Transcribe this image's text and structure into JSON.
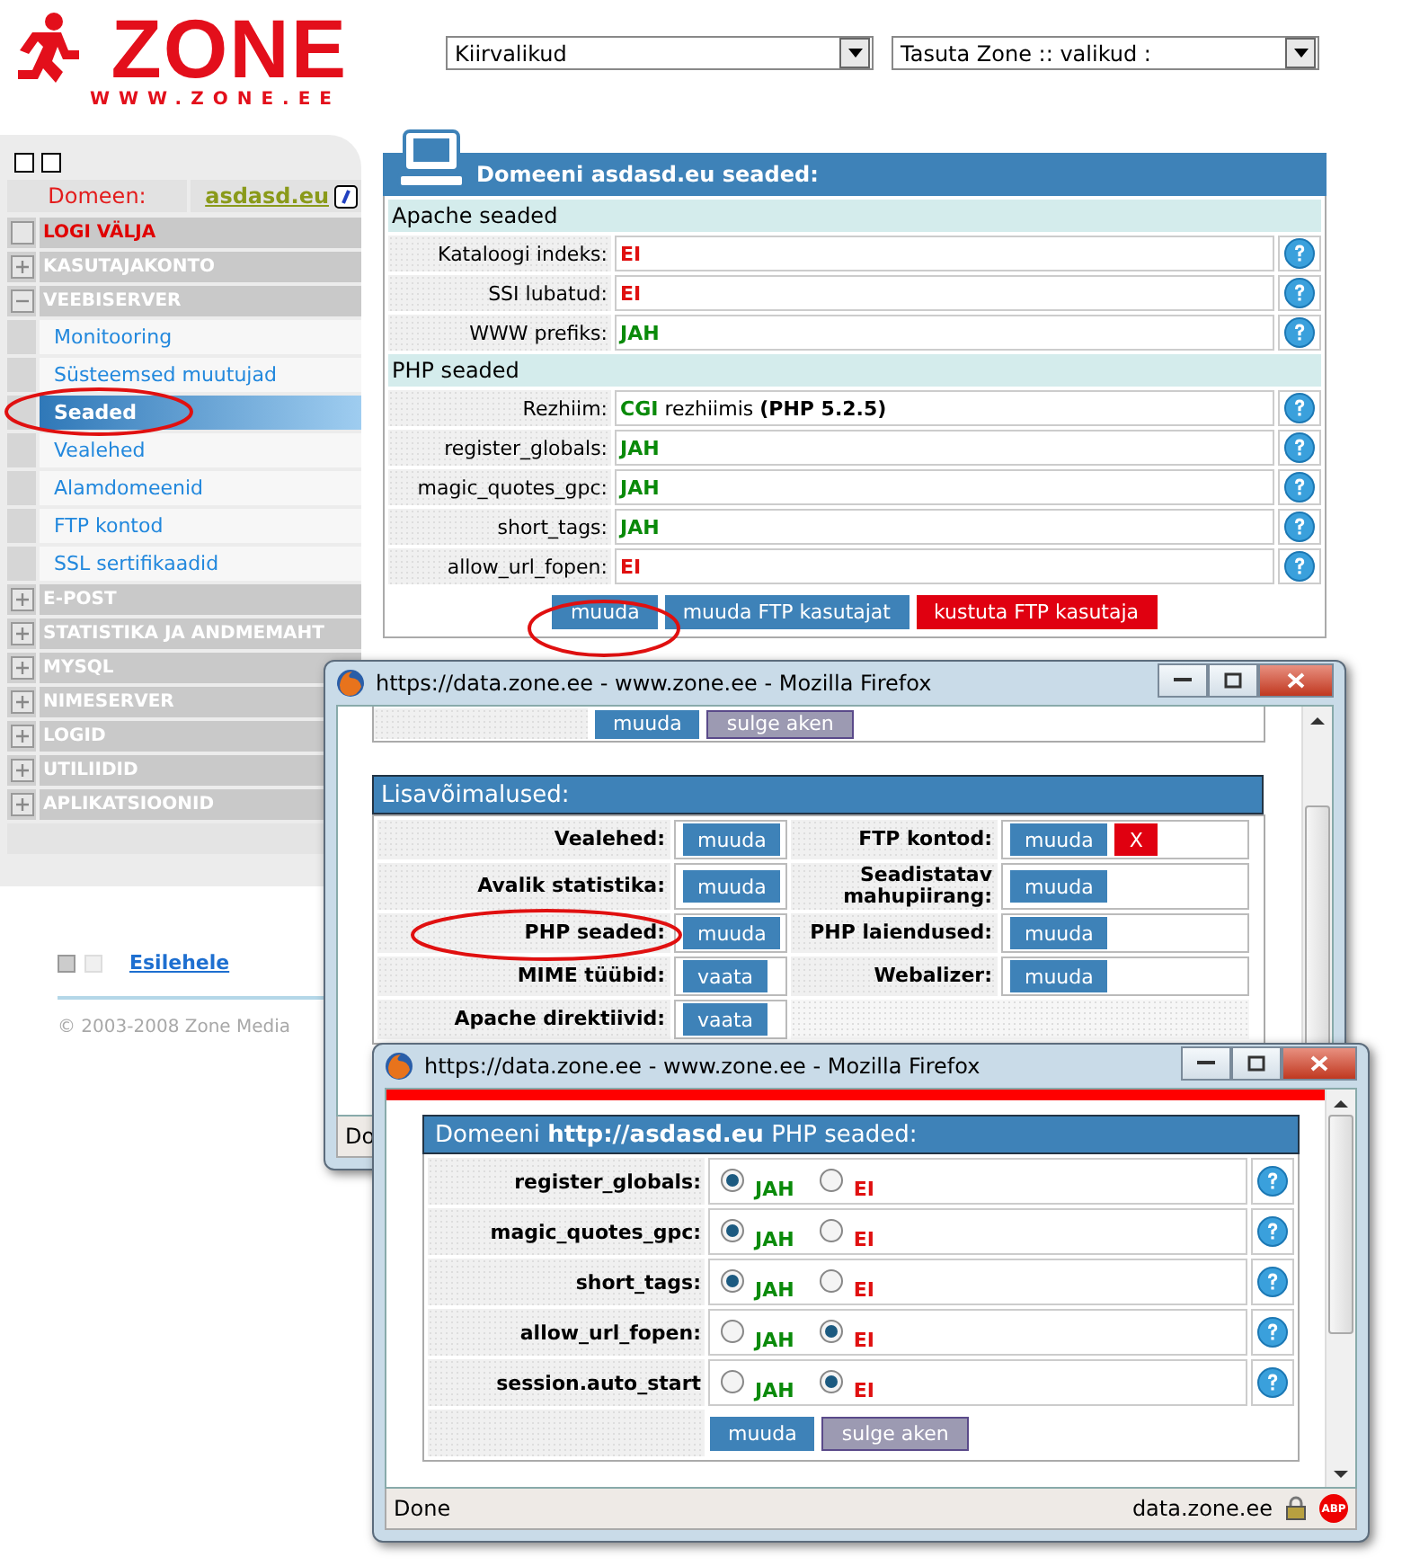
{
  "logo": {
    "wordmark": "ZONE",
    "url": "WWW.ZONE.EE"
  },
  "sidebar": {
    "domain_label": "Domeen:",
    "domain": "asdasd.eu",
    "menu": [
      {
        "label": "LOGI VÄLJA",
        "kind": "logout"
      },
      {
        "label": "KASUTAJAKONTO",
        "kind": "section",
        "expanded": false
      },
      {
        "label": "VEEBISERVER",
        "kind": "section",
        "expanded": true,
        "children": [
          {
            "label": "Monitooring",
            "selected": false
          },
          {
            "label": "Süsteemsed muutujad",
            "selected": false
          },
          {
            "label": "Seaded",
            "selected": true
          },
          {
            "label": "Vealehed",
            "selected": false
          },
          {
            "label": "Alamdomeenid",
            "selected": false
          },
          {
            "label": "FTP kontod",
            "selected": false
          },
          {
            "label": "SSL sertifikaadid",
            "selected": false
          }
        ]
      },
      {
        "label": "E-POST",
        "kind": "section",
        "expanded": false
      },
      {
        "label": "STATISTIKA JA ANDMEMAHT",
        "kind": "section",
        "expanded": false
      },
      {
        "label": "MYSQL",
        "kind": "section",
        "expanded": false
      },
      {
        "label": "NIMESERVER",
        "kind": "section",
        "expanded": false
      },
      {
        "label": "LOGID",
        "kind": "section",
        "expanded": false
      },
      {
        "label": "UTILIIDID",
        "kind": "section",
        "expanded": false
      },
      {
        "label": "APLIKATSIOONID",
        "kind": "section",
        "expanded": false
      }
    ]
  },
  "footer": {
    "link": "Esilehele",
    "copyright": "© 2003-2008 Zone Media"
  },
  "selects": [
    {
      "value": "Kiirvalikud"
    },
    {
      "value": "Tasuta Zone :: valikud :"
    }
  ],
  "settings": {
    "title": "Domeeni asdasd.eu seaded:",
    "sections": [
      {
        "heading": "Apache seaded",
        "rows": [
          {
            "label": "Kataloogi indeks:",
            "value": [
              {
                "text": "EI",
                "kind": "no"
              }
            ]
          },
          {
            "label": "SSI lubatud:",
            "value": [
              {
                "text": "EI",
                "kind": "no"
              }
            ]
          },
          {
            "label": "WWW prefiks:",
            "value": [
              {
                "text": "JAH",
                "kind": "yes"
              }
            ]
          }
        ]
      },
      {
        "heading": "PHP seaded",
        "rows": [
          {
            "label": "Rezhiim:",
            "value": [
              {
                "text": "CGI",
                "kind": "yes"
              },
              {
                "text": "rezhiimis",
                "kind": "plain"
              },
              {
                "text": "(PHP 5.2.5)",
                "kind": "bold"
              }
            ]
          },
          {
            "label": "register_globals:",
            "value": [
              {
                "text": "JAH",
                "kind": "yes"
              }
            ]
          },
          {
            "label": "magic_quotes_gpc:",
            "value": [
              {
                "text": "JAH",
                "kind": "yes"
              }
            ]
          },
          {
            "label": "short_tags:",
            "value": [
              {
                "text": "JAH",
                "kind": "yes"
              }
            ]
          },
          {
            "label": "allow_url_fopen:",
            "value": [
              {
                "text": "EI",
                "kind": "no"
              }
            ]
          }
        ]
      }
    ],
    "buttons": [
      {
        "label": "muuda",
        "kind": "primary"
      },
      {
        "label": "muuda FTP kasutajat",
        "kind": "primary"
      },
      {
        "label": "kustuta FTP kasutaja",
        "kind": "danger"
      }
    ]
  },
  "popup": {
    "title": "https://data.zone.ee - www.zone.ee - Mozilla Firefox",
    "top_buttons": [
      {
        "label": "muuda",
        "kind": "primary"
      },
      {
        "label": "sulge aken",
        "kind": "secondary"
      }
    ],
    "extras_title": "Lisavõimalused:",
    "extras": [
      {
        "label": "Vealehed:",
        "buttons": [
          {
            "label": "muuda",
            "kind": "primary"
          }
        ]
      },
      {
        "label": "FTP kontod:",
        "buttons": [
          {
            "label": "muuda",
            "kind": "primary"
          },
          {
            "label": "X",
            "kind": "danger"
          }
        ]
      },
      {
        "label": "Avalik statistika:",
        "buttons": [
          {
            "label": "muuda",
            "kind": "primary"
          }
        ]
      },
      {
        "label": "Seadistatav mahupiirang:",
        "buttons": [
          {
            "label": "muuda",
            "kind": "primary"
          }
        ]
      },
      {
        "label": "PHP seaded:",
        "buttons": [
          {
            "label": "muuda",
            "kind": "primary"
          }
        ]
      },
      {
        "label": "PHP laiendused:",
        "buttons": [
          {
            "label": "muuda",
            "kind": "primary"
          }
        ]
      },
      {
        "label": "MIME tüübid:",
        "buttons": [
          {
            "label": "vaata",
            "kind": "primary"
          }
        ]
      },
      {
        "label": "Webalizer:",
        "buttons": [
          {
            "label": "muuda",
            "kind": "primary"
          }
        ]
      },
      {
        "label": "Apache direktiivid:",
        "buttons": [
          {
            "label": "vaata",
            "kind": "primary"
          }
        ]
      }
    ],
    "status": "Do"
  },
  "php_popup": {
    "title": "https://data.zone.ee - www.zone.ee - Mozilla Firefox",
    "heading": "Domeeni **http://asdasd.eu** PHP seaded:",
    "rows": [
      {
        "label": "register_globals:",
        "options": [
          {
            "label": "JAH",
            "kind": "yes",
            "selected": true
          },
          {
            "label": "EI",
            "kind": "no",
            "selected": false
          }
        ]
      },
      {
        "label": "magic_quotes_gpc:",
        "options": [
          {
            "label": "JAH",
            "kind": "yes",
            "selected": true
          },
          {
            "label": "EI",
            "kind": "no",
            "selected": false
          }
        ]
      },
      {
        "label": "short_tags:",
        "options": [
          {
            "label": "JAH",
            "kind": "yes",
            "selected": true
          },
          {
            "label": "EI",
            "kind": "no",
            "selected": false
          }
        ]
      },
      {
        "label": "allow_url_fopen:",
        "options": [
          {
            "label": "JAH",
            "kind": "yes",
            "selected": false
          },
          {
            "label": "EI",
            "kind": "no",
            "selected": true
          }
        ]
      },
      {
        "label": "session.auto_start",
        "options": [
          {
            "label": "JAH",
            "kind": "yes",
            "selected": false
          },
          {
            "label": "EI",
            "kind": "no",
            "selected": true
          }
        ]
      }
    ],
    "buttons": [
      {
        "label": "muuda",
        "kind": "primary"
      },
      {
        "label": "sulge aken",
        "kind": "secondary"
      }
    ],
    "status": "Done",
    "host": "data.zone.ee",
    "adblock": "ABP"
  }
}
